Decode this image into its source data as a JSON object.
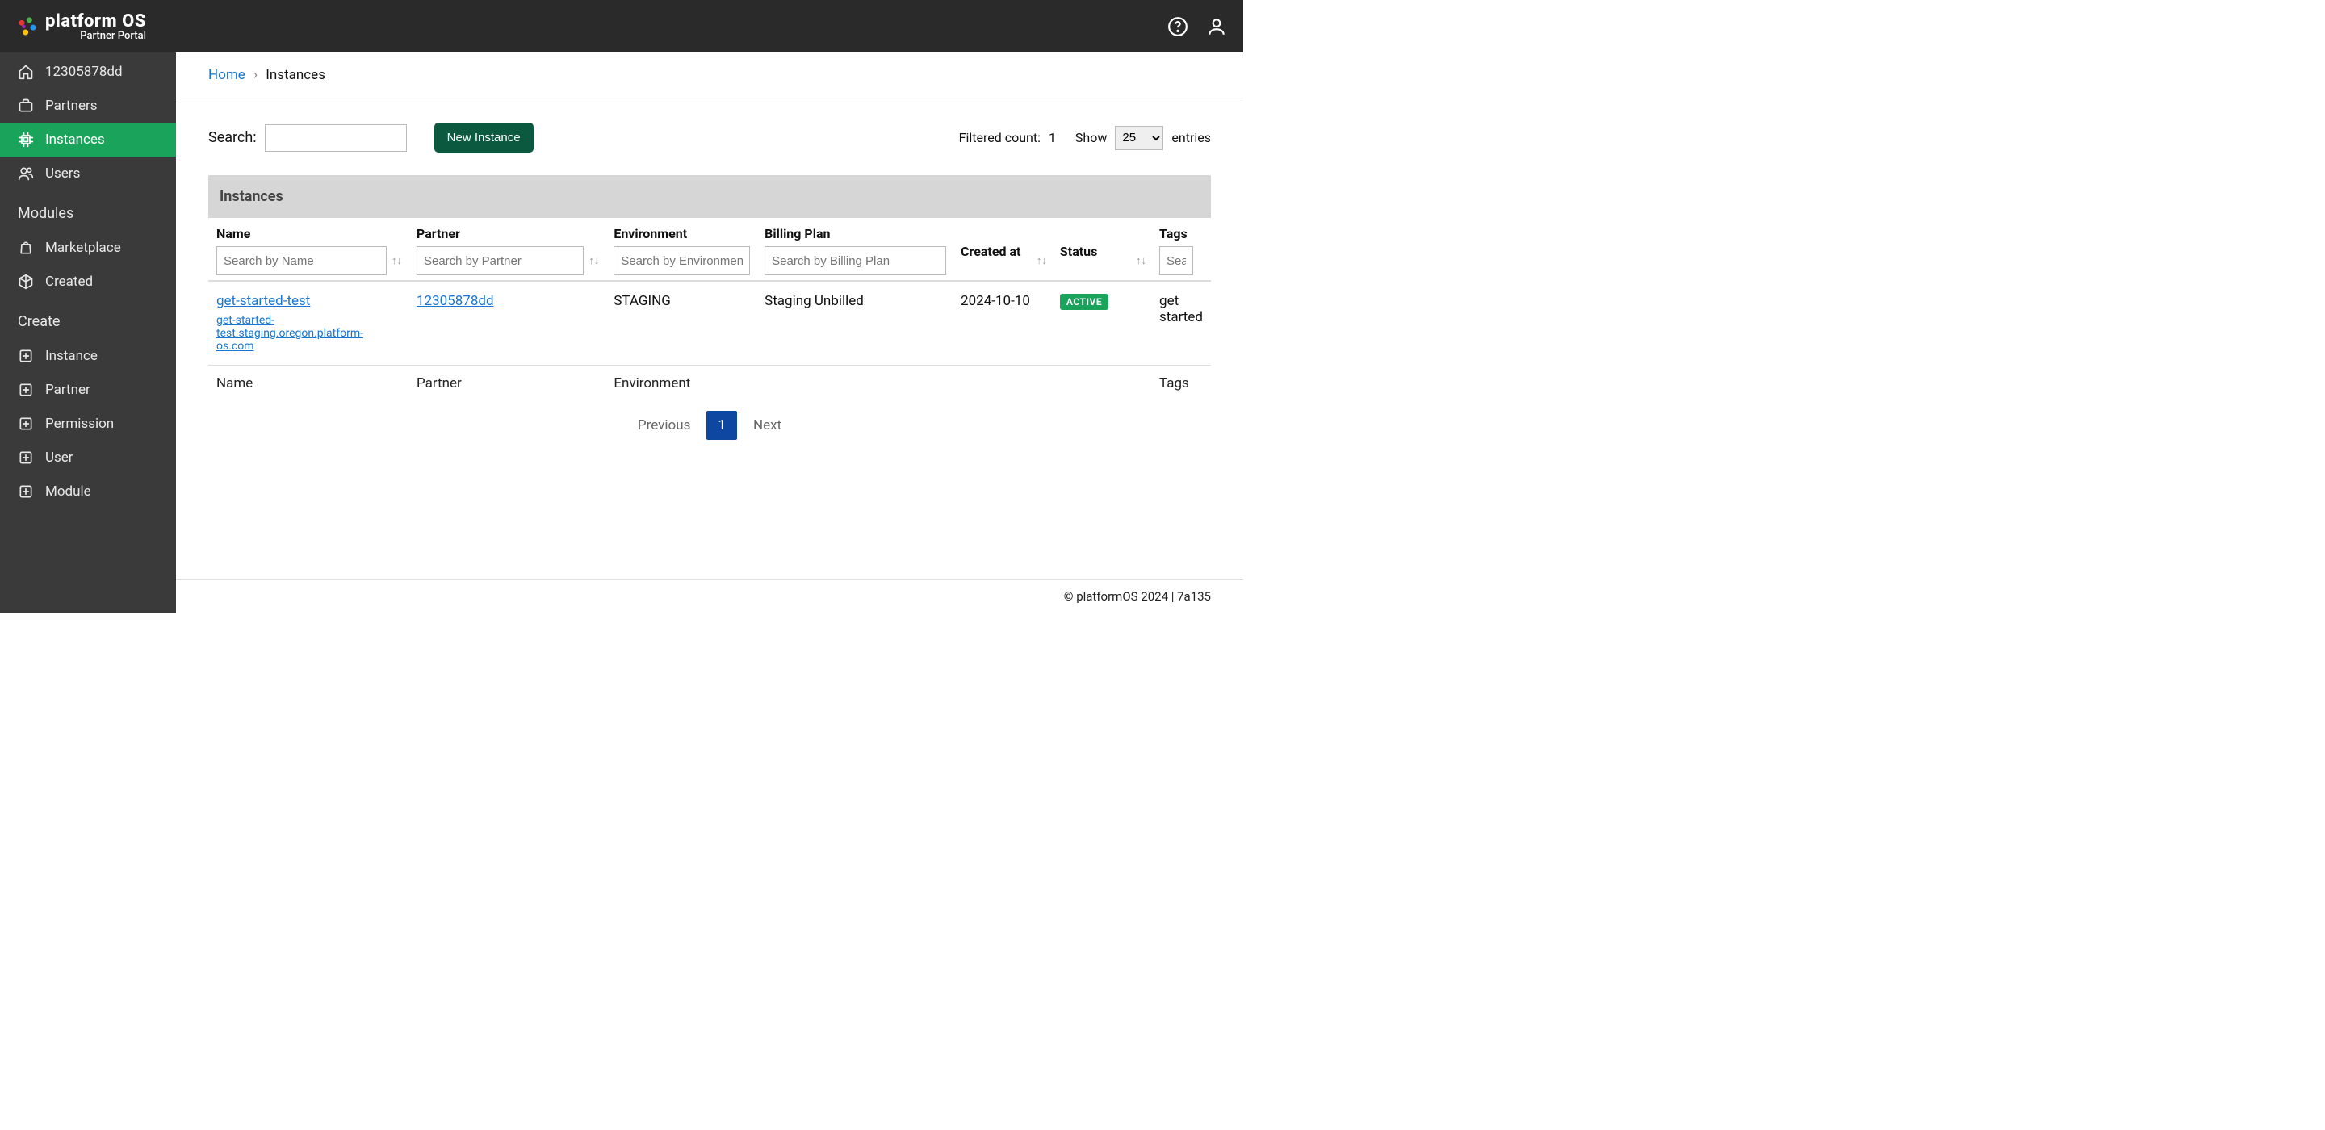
{
  "brand": {
    "name": "platform OS",
    "subtitle": "Partner Portal"
  },
  "topbar": {
    "help_icon": "help",
    "user_icon": "user"
  },
  "sidebar": {
    "primary": [
      {
        "icon": "home",
        "label": "12305878dd",
        "active": false
      },
      {
        "icon": "briefcase",
        "label": "Partners",
        "active": false
      },
      {
        "icon": "cpu",
        "label": "Instances",
        "active": true
      },
      {
        "icon": "users",
        "label": "Users",
        "active": false
      }
    ],
    "modules_header": "Modules",
    "modules": [
      {
        "icon": "bag",
        "label": "Marketplace"
      },
      {
        "icon": "cube",
        "label": "Created"
      }
    ],
    "create_header": "Create",
    "create": [
      {
        "icon": "plus-box",
        "label": "Instance"
      },
      {
        "icon": "plus-box",
        "label": "Partner"
      },
      {
        "icon": "plus-box",
        "label": "Permission"
      },
      {
        "icon": "plus-box",
        "label": "User"
      },
      {
        "icon": "plus-box",
        "label": "Module"
      }
    ]
  },
  "breadcrumb": {
    "home": "Home",
    "sep": "›",
    "current": "Instances"
  },
  "toolbar": {
    "search_label": "Search:",
    "search_value": "",
    "new_instance": "New Instance",
    "filtered_count_label": "Filtered count:",
    "filtered_count_value": "1",
    "show_label": "Show",
    "show_value": "25",
    "entries_label": "entries"
  },
  "table": {
    "title": "Instances",
    "columns": {
      "name": {
        "label": "Name",
        "placeholder": "Search by Name"
      },
      "partner": {
        "label": "Partner",
        "placeholder": "Search by Partner"
      },
      "environment": {
        "label": "Environment",
        "placeholder": "Search by Environment"
      },
      "billing_plan": {
        "label": "Billing Plan",
        "placeholder": "Search by Billing Plan"
      },
      "created_at": {
        "label": "Created at"
      },
      "status": {
        "label": "Status"
      },
      "tags": {
        "label": "Tags",
        "placeholder": "Search"
      }
    },
    "rows": [
      {
        "name": "get-started-test",
        "host": "get-started-test.staging.oregon.platform-os.com",
        "partner": "12305878dd",
        "environment": "STAGING",
        "billing_plan": "Staging Unbilled",
        "created_at": "2024-10-10",
        "status": "ACTIVE",
        "tags": "get started"
      }
    ],
    "footer_cols": {
      "name": "Name",
      "partner": "Partner",
      "environment": "Environment",
      "tags": "Tags"
    }
  },
  "pagination": {
    "previous": "Previous",
    "current_page": "1",
    "next": "Next"
  },
  "footer": {
    "text": "© platformOS 2024 | 7a135"
  }
}
